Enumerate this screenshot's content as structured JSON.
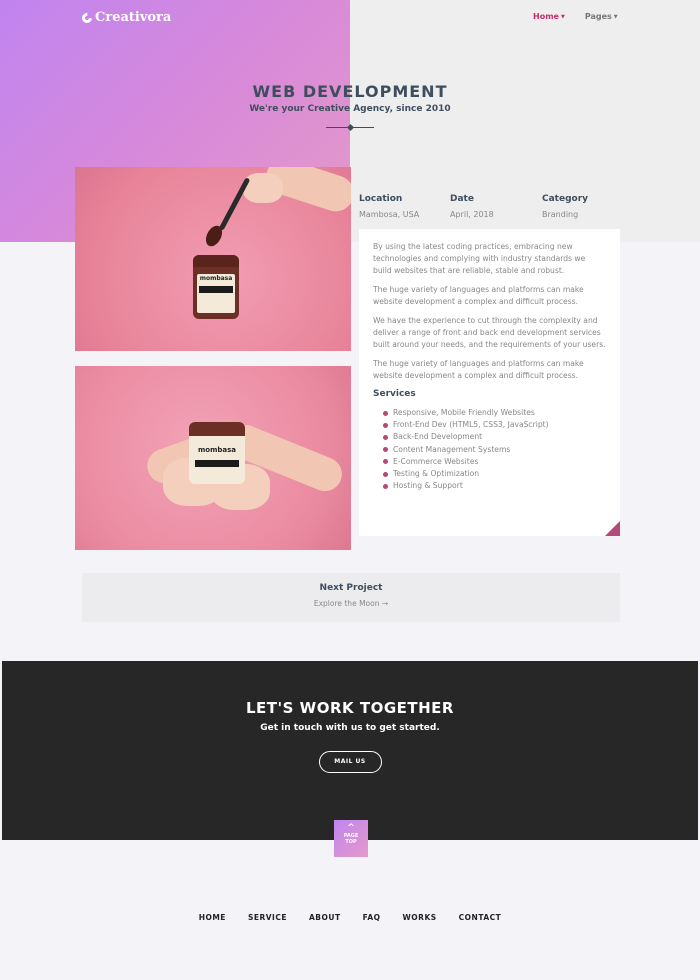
{
  "brand": {
    "name": "Creativora"
  },
  "nav": {
    "items": [
      "Home",
      "Pages"
    ]
  },
  "hero": {
    "title": "WEB DEVELOPMENT",
    "subtitle": "We're your Creative Agency, since 2010"
  },
  "photos": {
    "jar_label": "mombasa"
  },
  "meta": {
    "location_label": "Location",
    "location_value": "Mambosa, USA",
    "date_label": "Date",
    "date_value": "April, 2018",
    "category_label": "Category",
    "category_value": "Branding"
  },
  "card": {
    "paragraphs": [
      "By using the latest coding practices, embracing new technologies and complying with industry standards we build websites that are reliable, stable and robust.",
      "The huge variety of languages and platforms can make website development a complex and difficult process.",
      "We have the experience to cut through the complexity and deliver a range of front and back end development services built around your needs, and the requirements of your users.",
      "The huge variety of languages and platforms can make website development a complex and difficult process."
    ],
    "services_title": "Services",
    "services": [
      "Responsive, Mobile Friendly Websites",
      "Front-End Dev (HTML5, CSS3, JavaScript)",
      "Back-End Development",
      "Content Management Systems",
      "E-Commerce Websites",
      "Testing & Optimization",
      "Hosting & Support"
    ]
  },
  "next_project": {
    "title": "Next Project",
    "link": "Explore the Moon →"
  },
  "cta": {
    "title": "LET'S WORK TOGETHER",
    "subtitle": "Get in touch with us to get started.",
    "button": "MAIL US"
  },
  "page_top": {
    "line1": "PAGE",
    "line2": "TOP"
  },
  "footer_nav": [
    "HOME",
    "SERVICE",
    "ABOUT",
    "FAQ",
    "WORKS",
    "CONTACT"
  ],
  "colors": {
    "accent": "#b34a78",
    "gradient_start": "#c084f0",
    "gradient_end": "#e59ac8",
    "dark": "#272727"
  }
}
